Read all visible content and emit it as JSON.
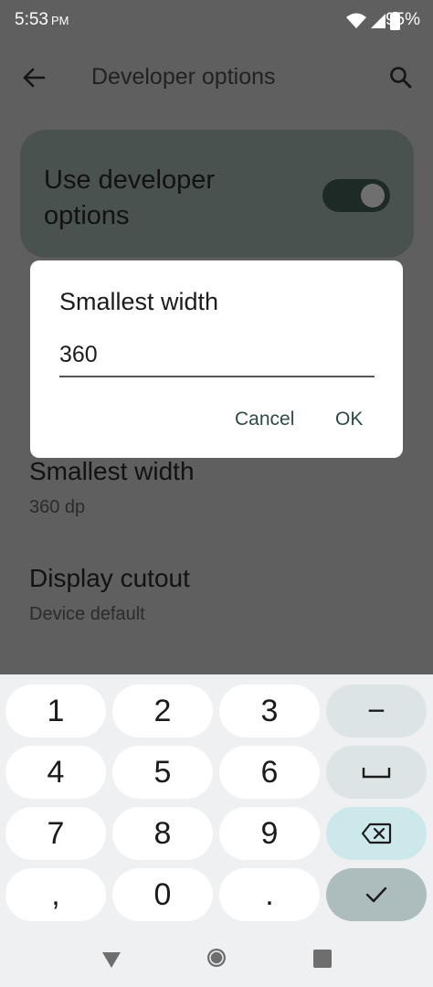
{
  "status_bar": {
    "time": "5:53",
    "ampm": "PM",
    "battery_percent": "95%",
    "icons": [
      "wifi-icon",
      "cellular-signal-icon",
      "battery-icon"
    ]
  },
  "app_bar": {
    "title": "Developer options",
    "back_icon": "back-arrow-icon",
    "search_icon": "search-icon"
  },
  "main_toggle": {
    "label": "Use developer options",
    "enabled": true
  },
  "settings": [
    {
      "title": "Smallest width",
      "summary": "360 dp"
    },
    {
      "title": "Display cutout",
      "summary": "Device default"
    }
  ],
  "dialog": {
    "title": "Smallest width",
    "input_value": "360",
    "cancel_label": "Cancel",
    "ok_label": "OK"
  },
  "keyboard": {
    "rows": [
      [
        "1",
        "2",
        "3",
        "−"
      ],
      [
        "4",
        "5",
        "6",
        "space-icon"
      ],
      [
        "7",
        "8",
        "9",
        "backspace-icon"
      ],
      [
        ",",
        "0",
        ".",
        "done-check-icon"
      ]
    ]
  },
  "nav_bar": {
    "icons": [
      "nav-back-icon",
      "nav-home-icon",
      "nav-recents-icon"
    ]
  },
  "colors": {
    "scrim_background": "#5f5f5f",
    "dialog_surface": "#ffffff",
    "dialog_button_text": "#2e4a46",
    "keyboard_background": "#eef0f1",
    "key_enter": "#adbcbc",
    "key_backspace": "#cce8ea"
  }
}
